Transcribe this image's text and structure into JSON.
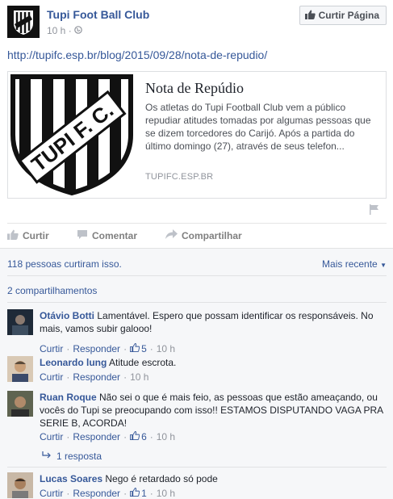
{
  "post": {
    "page_name": "Tupi Foot Ball Club",
    "time": "10 h",
    "privacy_icon": "globe-icon",
    "like_page_label": "Curtir Página",
    "link_url": "http://tupifc.esp.br/blog/2015/09/28/nota-de-repudio/"
  },
  "card": {
    "logo_text": "TUPI F. C.",
    "title": "Nota de Repúdio",
    "description": "Os atletas do Tupi Football Club vem a público repudiar atitudes tomadas por algumas pessoas que se dizem torcedores do Carijó. Após a partida do último domingo (27), através de seus telefon...",
    "domain": "TUPIFC.ESP.BR"
  },
  "actions": {
    "like": "Curtir",
    "comment": "Comentar",
    "share": "Compartilhar"
  },
  "ufi": {
    "likes_text": "118 pessoas curtiram isso.",
    "sort_label": "Mais recente",
    "shares_text": "2 compartilhamentos"
  },
  "comments": [
    {
      "author": "Otávio Botti",
      "text": "Lamentável. Espero que possam identificar os responsáveis. No mais, vamos subir galooo!",
      "like_label": "Curtir",
      "reply_label": "Responder",
      "likes": "5",
      "time": "10 h",
      "avatar_color": "#2b3a4a"
    },
    {
      "author": "Leonardo lung",
      "text": "Atitude escrota.",
      "like_label": "Curtir",
      "reply_label": "Responder",
      "likes": "",
      "time": "10 h",
      "avatar_color": "#c9a98a"
    },
    {
      "author": "Ruan Roque",
      "text": "Não sei o que é mais feio, as pessoas que estão ameaçando, ou vocês do Tupi se preocupando com isso!! ESTAMOS DISPUTANDO VAGA PRA SERIE B, ACORDA!",
      "like_label": "Curtir",
      "reply_label": "Responder",
      "likes": "6",
      "time": "10 h",
      "avatar_color": "#6b6f5a",
      "replies": "1 resposta"
    },
    {
      "author": "Lucas Soares",
      "text": "Nego é retardado só pode",
      "like_label": "Curtir",
      "reply_label": "Responder",
      "likes": "1",
      "time": "10 h",
      "avatar_color": "#a88f7a"
    }
  ],
  "colors": {
    "link": "#365899",
    "meta": "#90949c",
    "ufi_bg": "#f6f7f9"
  }
}
